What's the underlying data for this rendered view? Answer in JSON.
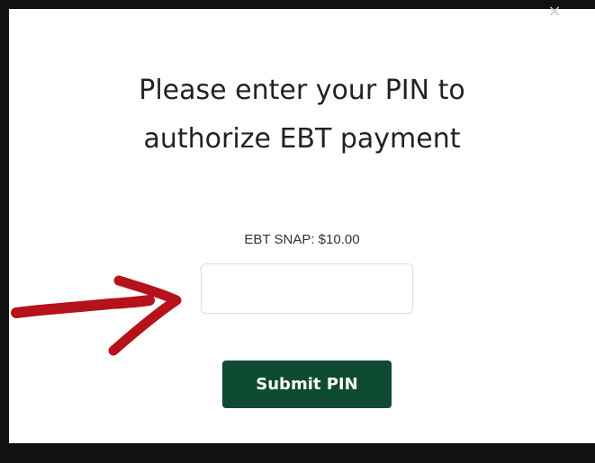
{
  "modal": {
    "close_symbol": "×",
    "title_line_1": "Please enter your PIN to",
    "title_line_2": "authorize EBT payment",
    "amount_label": "EBT SNAP: $10.00",
    "pin_value": "",
    "pin_placeholder": "",
    "submit_label": "Submit PIN"
  },
  "icons": {
    "close": "close-icon",
    "annotation": "red-arrow-icon"
  },
  "colors": {
    "submit_button_bg": "#0f4a33",
    "annotation_arrow": "#b5121b"
  }
}
